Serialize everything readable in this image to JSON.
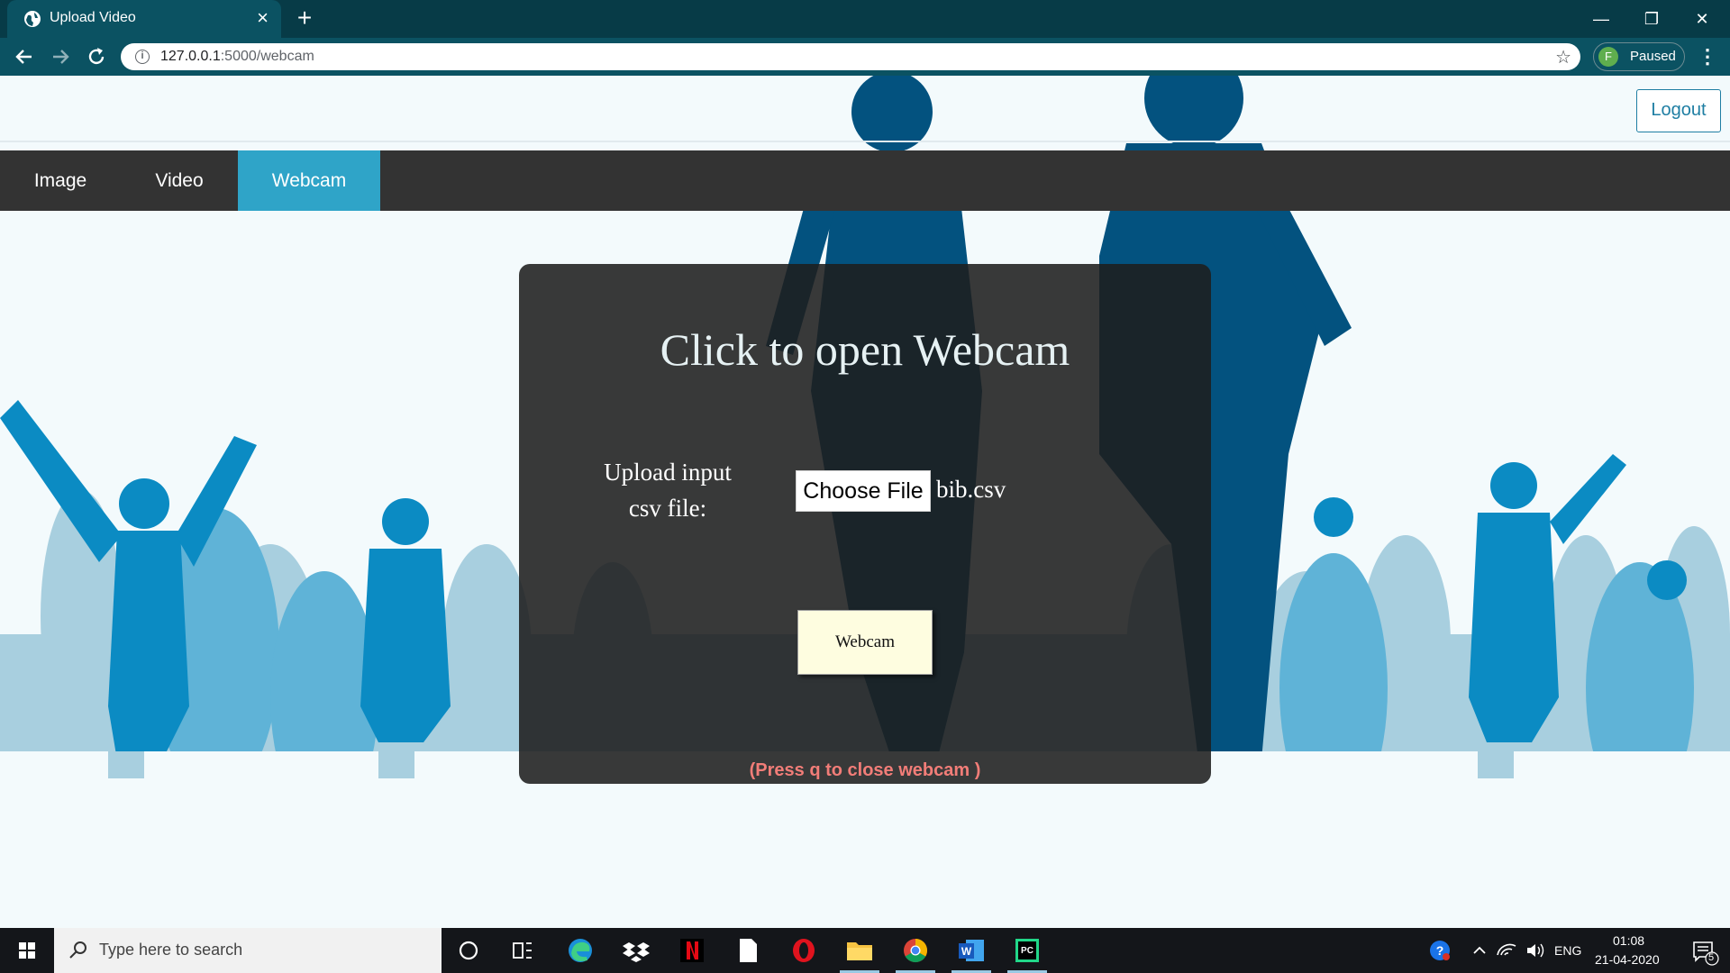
{
  "browser": {
    "tab_title": "Upload Video",
    "tab_close": "×",
    "new_tab": "+",
    "url_host": "127.0.0.1",
    "url_path": ":5000/webcam",
    "profile_initial": "F",
    "profile_status": "Paused",
    "window_controls": {
      "minimize": "—",
      "restore": "❐",
      "close": "✕"
    }
  },
  "header": {
    "logout_label": "Logout"
  },
  "navbar": {
    "items": [
      {
        "label": "Image",
        "active": false
      },
      {
        "label": "Video",
        "active": false
      },
      {
        "label": "Webcam",
        "active": true
      }
    ]
  },
  "panel": {
    "title": "Click to open Webcam",
    "upload_label_line1": "Upload input",
    "upload_label_line2": "csv file:",
    "choose_file_label": "Choose File",
    "file_name": "bib.csv",
    "webcam_button_label": "Webcam",
    "note": "(Press q to close webcam )"
  },
  "taskbar": {
    "search_placeholder": "Type here to search",
    "language": "ENG",
    "time": "01:08",
    "date": "21-04-2020",
    "notification_count": "5",
    "apps": [
      "windows-start-icon",
      "cortana-icon",
      "task-view-icon",
      "edge-icon",
      "dropbox-icon",
      "netflix-icon",
      "file-icon",
      "opera-icon",
      "file-explorer-icon",
      "chrome-icon",
      "word-icon",
      "pycharm-icon"
    ]
  },
  "colors": {
    "nav_active": "#2fa4c8",
    "navbar_bg": "#333333",
    "logout_accent": "#1e7ea3",
    "note_color": "#f27d78",
    "browser_frame": "#0b5262"
  }
}
